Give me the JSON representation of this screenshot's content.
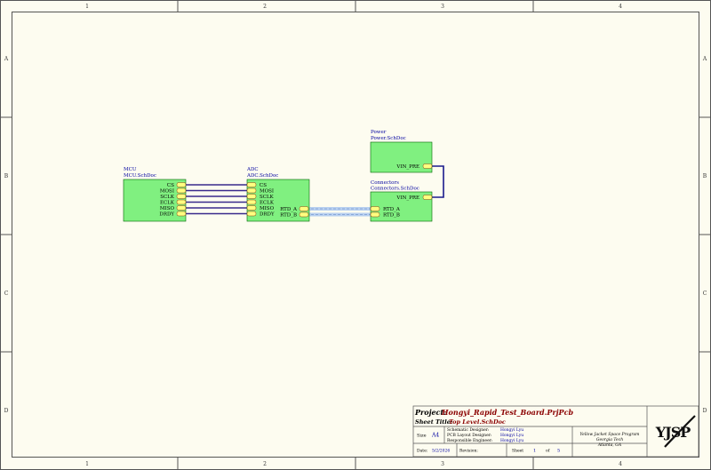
{
  "border": {
    "columns": [
      "1",
      "2",
      "3",
      "4"
    ],
    "rows": [
      "A",
      "B",
      "C",
      "D"
    ]
  },
  "sheets": {
    "mcu": {
      "designator": "MCU",
      "filename": "MCU.SchDoc",
      "ports": [
        "CS",
        "MOSI",
        "SCLK",
        "ECLK",
        "MISO",
        "DRDY"
      ]
    },
    "adc": {
      "designator": "ADC",
      "filename": "ADC.SchDoc",
      "ports_left": [
        "CS",
        "MOSI",
        "SCLK",
        "ECLK",
        "MISO",
        "DRDY"
      ],
      "ports_right": [
        "RTD_A",
        "RTD_B"
      ]
    },
    "power": {
      "designator": "Power",
      "filename": "Power.SchDoc",
      "ports": [
        "VIN_PRE"
      ]
    },
    "connectors": {
      "designator": "Connectors",
      "filename": "Connectors.SchDoc",
      "ports": [
        "VIN_PRE",
        "RTD_A",
        "RTD_B"
      ]
    }
  },
  "title_block": {
    "project_label": "Project:",
    "project": "Hongyi_Rapid_Test_Board.PrjPcb",
    "sheet_title_label": "Sheet Title:",
    "sheet_title": "Top Level.SchDoc",
    "size_label": "Size",
    "size": "A4",
    "schematic_designer_label": "Schematic Designer:",
    "schematic_designer": "Hongyi Lyu",
    "pcb_designer_label": "PCB Layout Designer:",
    "pcb_designer": "Hongyi Lyu",
    "engineer_label": "Responsible Engineer:",
    "engineer": "Hongyi Lyu",
    "org_line1": "Yellow Jacket Space Program",
    "org_line2": "Georgia Tech",
    "org_line3": "Atlanta, GA",
    "date_label": "Date:",
    "date": "5/2/2026",
    "revision_label": "Revision:",
    "sheet_label": "Sheet",
    "sheet_num": "1",
    "of_label": "of",
    "sheet_total": "5",
    "logo_text": "YJSP"
  },
  "colors": {
    "sheet_fill": "#80f080",
    "sheet_border": "#006400",
    "port_fill": "#ffff80",
    "wire": "#1a1a8c",
    "bus": "#b8d0f0",
    "label_blue": "#0000a0",
    "title_red": "#8b0000"
  }
}
